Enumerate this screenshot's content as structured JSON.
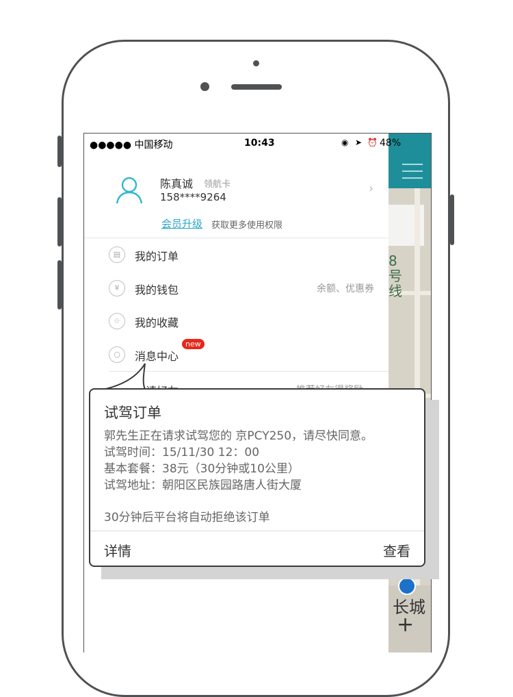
{
  "status_bar": {
    "carrier": "●●●●● 中国移动",
    "time": "10:43",
    "battery": "48%"
  },
  "profile": {
    "name": "陈真诚",
    "card_type": "领航卡",
    "phone": "158****9264",
    "upgrade_link": "会员升级",
    "upgrade_desc": "获取更多使用权限"
  },
  "menu": {
    "orders": "我的订单",
    "wallet": "我的钱包",
    "wallet_extra": "余额、优惠券",
    "favorites": "我的收藏",
    "messages": "消息中心",
    "new_badge": "new",
    "invite": "邀请好友",
    "invite_extra": "推荐好友得奖励"
  },
  "map": {
    "label": "8号线",
    "city_text": "长城"
  },
  "popup": {
    "title": "试驾订单",
    "line1": "郭先生正在请求试驾您的 京PCY250，请尽快同意。",
    "line2": "试驾时间：15/11/30  12：00",
    "line3": "基本套餐：38元（30分钟或10公里）",
    "line4": "试驾地址：朝阳区民族园路唐人街大厦",
    "note": "30分钟后平台将自动拒绝该订单",
    "details_button": "详情",
    "view_button": "查看"
  }
}
